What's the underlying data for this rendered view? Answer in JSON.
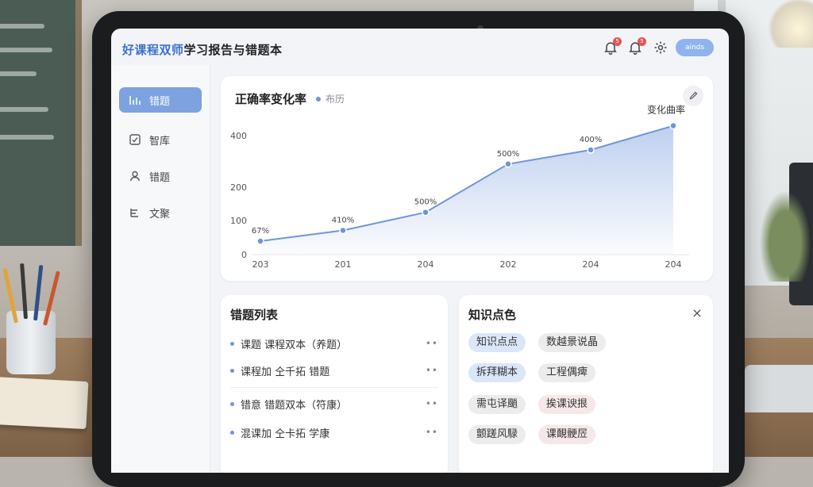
{
  "app": {
    "title_brand": "好课程双师",
    "title_rest": "学习报告与错题本",
    "notifications": [
      {
        "badge": "5"
      },
      {
        "badge": "5"
      }
    ],
    "user_label": "ainds"
  },
  "sidebar": {
    "items": [
      {
        "label": "错题",
        "icon": "bar-chart-icon",
        "active": true
      },
      {
        "label": "智库",
        "icon": "checkbox-icon",
        "active": false
      },
      {
        "label": "错题",
        "icon": "user-icon",
        "active": false
      },
      {
        "label": "文聚",
        "icon": "list-icon",
        "active": false
      }
    ]
  },
  "chart_card": {
    "title": "正确率变化率",
    "legend": "布历",
    "series_label": "变化曲率"
  },
  "chart_data": {
    "type": "area",
    "title": "正确率变化率",
    "x": [
      "203",
      "201",
      "204",
      "202",
      "204",
      "204"
    ],
    "y_ticks": [
      "0",
      "100",
      "200",
      "400"
    ],
    "series": [
      {
        "name": "变化曲率",
        "values": [
          67,
          120,
          210,
          450,
          520,
          640
        ],
        "labels": [
          "67%",
          "410%",
          "500%",
          "500%",
          "400%",
          ""
        ]
      }
    ],
    "ylim": [
      0,
      650
    ],
    "grid": true,
    "color": "#6d95dc"
  },
  "mistakes": {
    "title": "错题列表",
    "more_label": "••",
    "items": [
      "课题 课程双本（养题）",
      "课程加 仝千拓 错题",
      "错意 错题双本（符康）",
      "混课加 仝卡拓 学康"
    ]
  },
  "knowledge": {
    "title": "知识点色",
    "close_label": "×",
    "tags": [
      {
        "label": "知识点点",
        "style": "blue"
      },
      {
        "label": "数越景说晶",
        "style": "gray"
      },
      {
        "label": "拆拜糊本",
        "style": "blue"
      },
      {
        "label": "工程偶痺",
        "style": "gray"
      },
      {
        "label": "需屯译颵",
        "style": "gray"
      },
      {
        "label": "挨课谀拫",
        "style": "pink"
      },
      {
        "label": "颤蹉风騄",
        "style": "gray"
      },
      {
        "label": "课靦骾㞐",
        "style": "pink"
      }
    ]
  }
}
